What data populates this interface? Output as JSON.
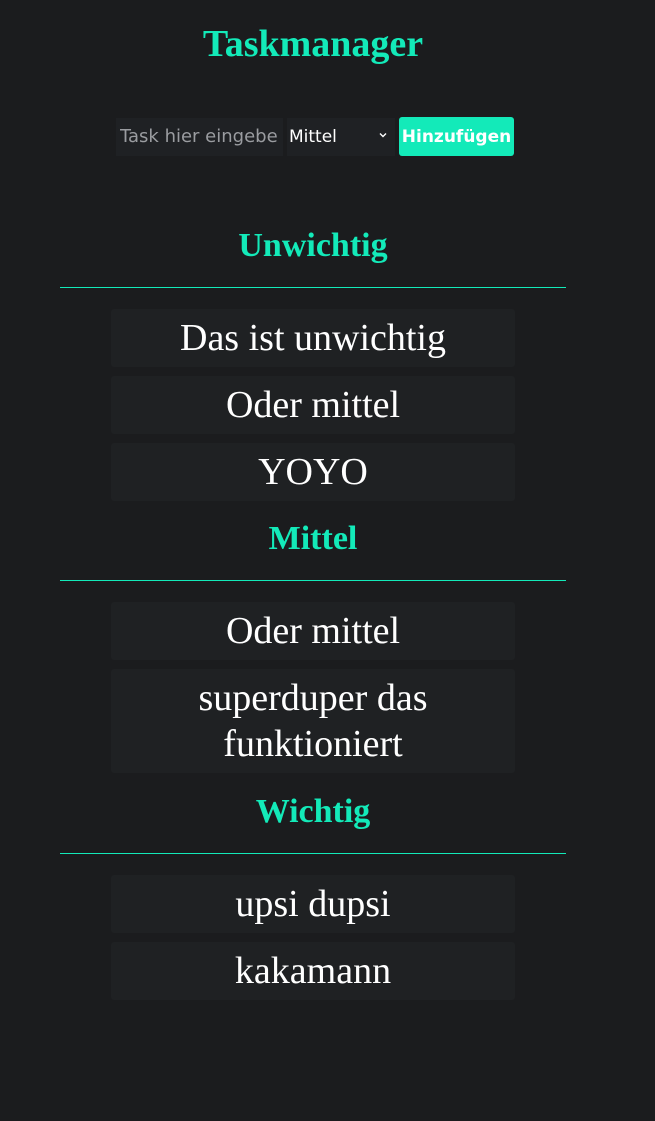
{
  "header": {
    "title": "Taskmanager"
  },
  "form": {
    "input_placeholder": "Task hier eingeben",
    "input_value": "",
    "priority_selected": "Mittel",
    "add_label": "Hinzufügen"
  },
  "sections": [
    {
      "title": "Unwichtig",
      "tasks": [
        "Das ist unwichtig",
        "Oder mittel",
        "YOYO"
      ]
    },
    {
      "title": "Mittel",
      "tasks": [
        "Oder mittel",
        "superduper das funktioniert"
      ]
    },
    {
      "title": "Wichtig",
      "tasks": [
        "upsi dupsi",
        "kakamann"
      ]
    }
  ],
  "colors": {
    "background": "#1b1c1e",
    "accent": "#13eab9",
    "task_background": "#1f2123",
    "text": "#ffffff"
  }
}
